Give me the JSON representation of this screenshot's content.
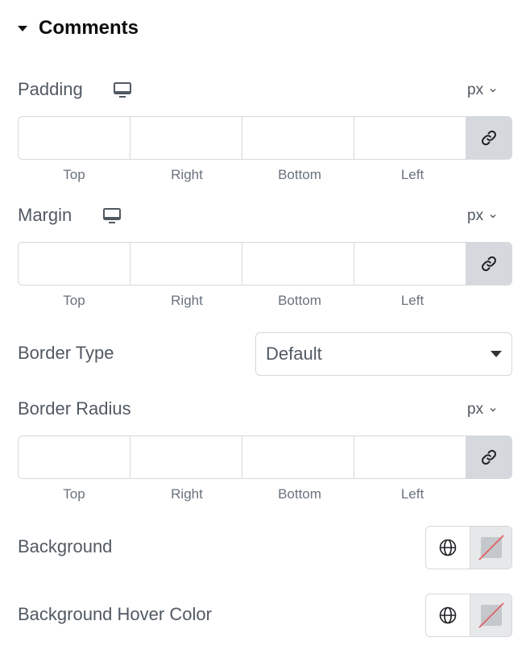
{
  "section": {
    "title": "Comments",
    "caret_icon": "caret-down-icon"
  },
  "padding": {
    "label": "Padding",
    "unit": "px",
    "fields": [
      "Top",
      "Right",
      "Bottom",
      "Left"
    ],
    "values": [
      "",
      "",
      "",
      ""
    ]
  },
  "margin": {
    "label": "Margin",
    "unit": "px",
    "fields": [
      "Top",
      "Right",
      "Bottom",
      "Left"
    ],
    "values": [
      "",
      "",
      "",
      ""
    ]
  },
  "border_type": {
    "label": "Border Type",
    "value": "Default"
  },
  "border_radius": {
    "label": "Border Radius",
    "unit": "px",
    "fields": [
      "Top",
      "Right",
      "Bottom",
      "Left"
    ],
    "values": [
      "",
      "",
      "",
      ""
    ]
  },
  "background": {
    "label": "Background",
    "color": "none"
  },
  "background_hover": {
    "label": "Background Hover Color",
    "color": "none"
  },
  "colors": {
    "border": "#d5d8dc",
    "link_bg": "#d5d8dc",
    "text": "#515962",
    "sublabel": "#69727d",
    "no_color_slash": "#e25b5b"
  }
}
